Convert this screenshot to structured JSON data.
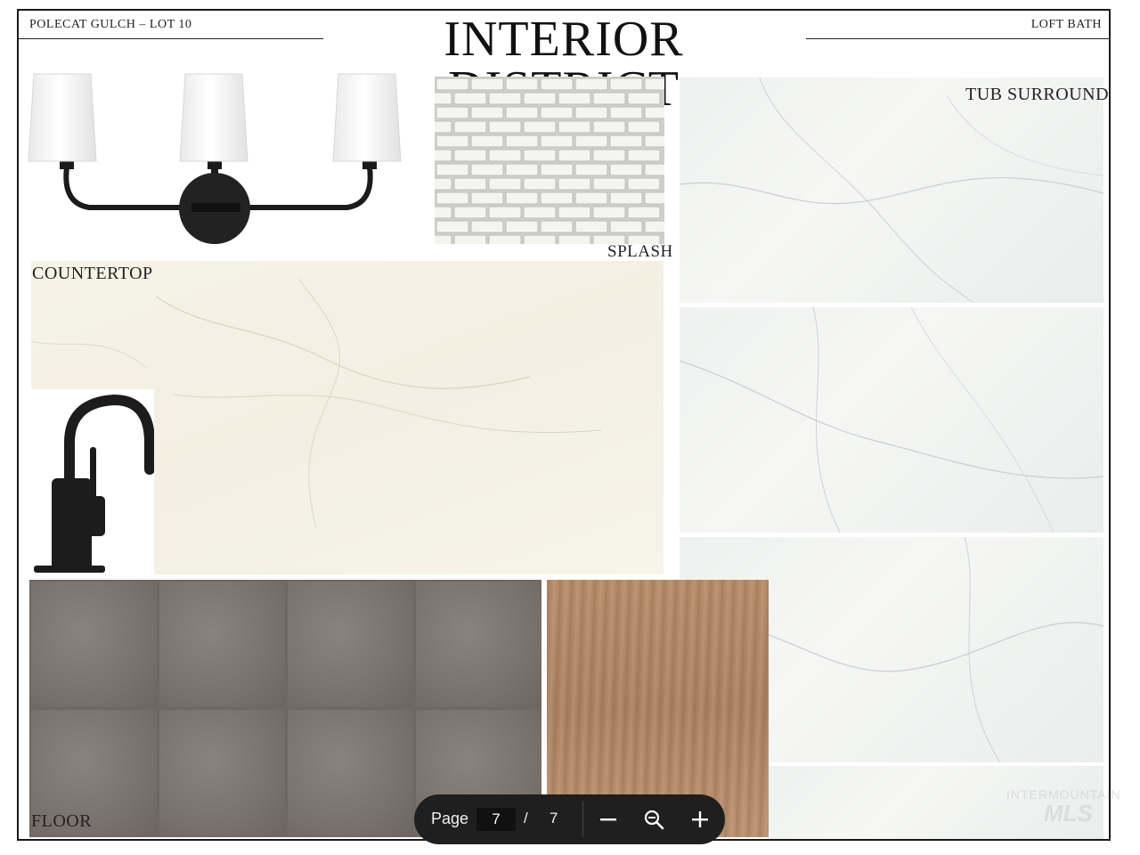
{
  "header": {
    "left": "POLECAT GULCH – LOT 10",
    "title": "INTERIOR DISTRICT",
    "right": "LOFT BATH"
  },
  "labels": {
    "tub_surround": "TUB SURROUND",
    "splash": "SPLASH",
    "countertop": "COUNTERTOP",
    "floor": "FLOOR"
  },
  "viewer": {
    "page_label": "Page",
    "current_page": "7",
    "separator": "/",
    "total_pages": "7"
  },
  "watermark": {
    "line1": "INTERMOUNTAIN",
    "line2": "MLS"
  }
}
